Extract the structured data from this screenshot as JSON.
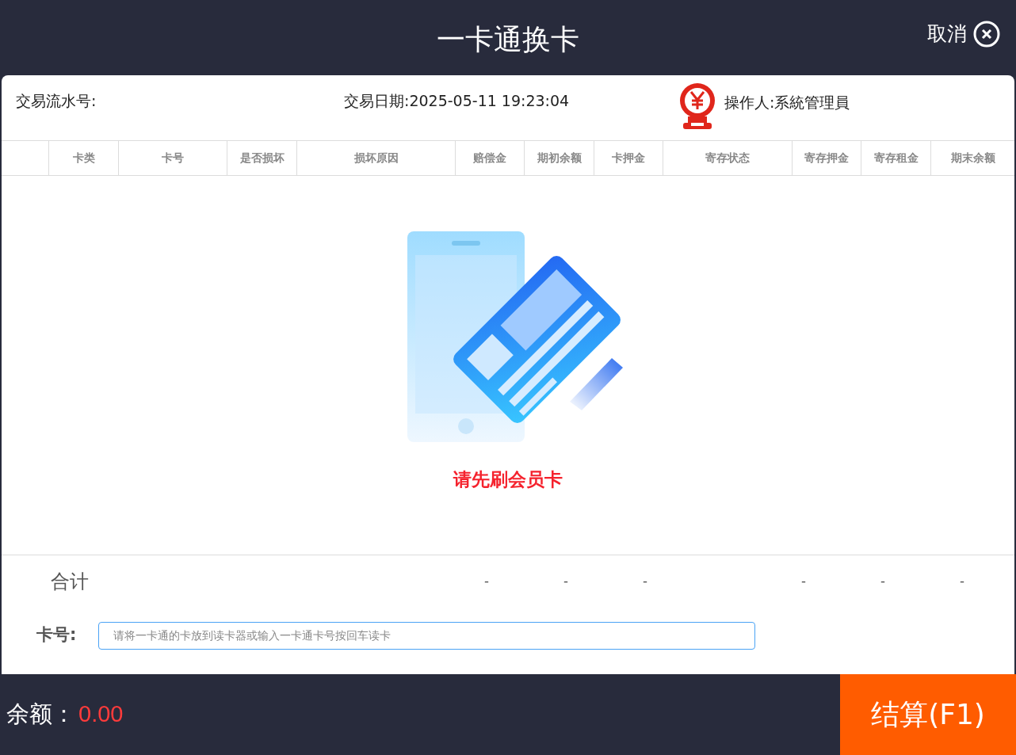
{
  "window": {
    "title": "一卡通换卡",
    "cancel": "取消"
  },
  "info": {
    "serial_label": "交易流水号:",
    "date": "交易日期:2025-05-11 19:23:04",
    "operator": "操作人:系統管理員"
  },
  "table": {
    "columns": [
      "卡类",
      "卡号",
      "是否损坏",
      "损坏原因",
      "赔偿金",
      "期初余额",
      "卡押金",
      "寄存状态",
      "寄存押金",
      "寄存租金",
      "期末余额"
    ],
    "empty_message": "请先刷会员卡"
  },
  "totals": {
    "label": "合计",
    "values": [
      "-",
      "-",
      "-",
      "-",
      "-",
      "-"
    ]
  },
  "card_field": {
    "label": "卡号:",
    "placeholder": "请将一卡通的卡放到读卡器或输入一卡通卡号按回车读卡"
  },
  "footer": {
    "balance_label": "余额：",
    "balance": "0.00",
    "checkout": "结算(F1)"
  }
}
